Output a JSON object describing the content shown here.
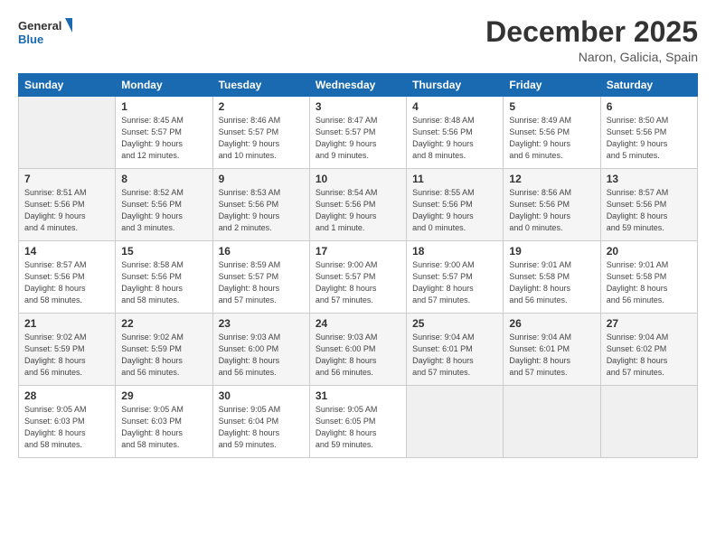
{
  "logo": {
    "line1": "General",
    "line2": "Blue"
  },
  "title": "December 2025",
  "location": "Naron, Galicia, Spain",
  "days_header": [
    "Sunday",
    "Monday",
    "Tuesday",
    "Wednesday",
    "Thursday",
    "Friday",
    "Saturday"
  ],
  "weeks": [
    [
      {
        "day": "",
        "info": ""
      },
      {
        "day": "1",
        "info": "Sunrise: 8:45 AM\nSunset: 5:57 PM\nDaylight: 9 hours\nand 12 minutes."
      },
      {
        "day": "2",
        "info": "Sunrise: 8:46 AM\nSunset: 5:57 PM\nDaylight: 9 hours\nand 10 minutes."
      },
      {
        "day": "3",
        "info": "Sunrise: 8:47 AM\nSunset: 5:57 PM\nDaylight: 9 hours\nand 9 minutes."
      },
      {
        "day": "4",
        "info": "Sunrise: 8:48 AM\nSunset: 5:56 PM\nDaylight: 9 hours\nand 8 minutes."
      },
      {
        "day": "5",
        "info": "Sunrise: 8:49 AM\nSunset: 5:56 PM\nDaylight: 9 hours\nand 6 minutes."
      },
      {
        "day": "6",
        "info": "Sunrise: 8:50 AM\nSunset: 5:56 PM\nDaylight: 9 hours\nand 5 minutes."
      }
    ],
    [
      {
        "day": "7",
        "info": "Sunrise: 8:51 AM\nSunset: 5:56 PM\nDaylight: 9 hours\nand 4 minutes."
      },
      {
        "day": "8",
        "info": "Sunrise: 8:52 AM\nSunset: 5:56 PM\nDaylight: 9 hours\nand 3 minutes."
      },
      {
        "day": "9",
        "info": "Sunrise: 8:53 AM\nSunset: 5:56 PM\nDaylight: 9 hours\nand 2 minutes."
      },
      {
        "day": "10",
        "info": "Sunrise: 8:54 AM\nSunset: 5:56 PM\nDaylight: 9 hours\nand 1 minute."
      },
      {
        "day": "11",
        "info": "Sunrise: 8:55 AM\nSunset: 5:56 PM\nDaylight: 9 hours\nand 0 minutes."
      },
      {
        "day": "12",
        "info": "Sunrise: 8:56 AM\nSunset: 5:56 PM\nDaylight: 9 hours\nand 0 minutes."
      },
      {
        "day": "13",
        "info": "Sunrise: 8:57 AM\nSunset: 5:56 PM\nDaylight: 8 hours\nand 59 minutes."
      }
    ],
    [
      {
        "day": "14",
        "info": "Sunrise: 8:57 AM\nSunset: 5:56 PM\nDaylight: 8 hours\nand 58 minutes."
      },
      {
        "day": "15",
        "info": "Sunrise: 8:58 AM\nSunset: 5:56 PM\nDaylight: 8 hours\nand 58 minutes."
      },
      {
        "day": "16",
        "info": "Sunrise: 8:59 AM\nSunset: 5:57 PM\nDaylight: 8 hours\nand 57 minutes."
      },
      {
        "day": "17",
        "info": "Sunrise: 9:00 AM\nSunset: 5:57 PM\nDaylight: 8 hours\nand 57 minutes."
      },
      {
        "day": "18",
        "info": "Sunrise: 9:00 AM\nSunset: 5:57 PM\nDaylight: 8 hours\nand 57 minutes."
      },
      {
        "day": "19",
        "info": "Sunrise: 9:01 AM\nSunset: 5:58 PM\nDaylight: 8 hours\nand 56 minutes."
      },
      {
        "day": "20",
        "info": "Sunrise: 9:01 AM\nSunset: 5:58 PM\nDaylight: 8 hours\nand 56 minutes."
      }
    ],
    [
      {
        "day": "21",
        "info": "Sunrise: 9:02 AM\nSunset: 5:59 PM\nDaylight: 8 hours\nand 56 minutes."
      },
      {
        "day": "22",
        "info": "Sunrise: 9:02 AM\nSunset: 5:59 PM\nDaylight: 8 hours\nand 56 minutes."
      },
      {
        "day": "23",
        "info": "Sunrise: 9:03 AM\nSunset: 6:00 PM\nDaylight: 8 hours\nand 56 minutes."
      },
      {
        "day": "24",
        "info": "Sunrise: 9:03 AM\nSunset: 6:00 PM\nDaylight: 8 hours\nand 56 minutes."
      },
      {
        "day": "25",
        "info": "Sunrise: 9:04 AM\nSunset: 6:01 PM\nDaylight: 8 hours\nand 57 minutes."
      },
      {
        "day": "26",
        "info": "Sunrise: 9:04 AM\nSunset: 6:01 PM\nDaylight: 8 hours\nand 57 minutes."
      },
      {
        "day": "27",
        "info": "Sunrise: 9:04 AM\nSunset: 6:02 PM\nDaylight: 8 hours\nand 57 minutes."
      }
    ],
    [
      {
        "day": "28",
        "info": "Sunrise: 9:05 AM\nSunset: 6:03 PM\nDaylight: 8 hours\nand 58 minutes."
      },
      {
        "day": "29",
        "info": "Sunrise: 9:05 AM\nSunset: 6:03 PM\nDaylight: 8 hours\nand 58 minutes."
      },
      {
        "day": "30",
        "info": "Sunrise: 9:05 AM\nSunset: 6:04 PM\nDaylight: 8 hours\nand 59 minutes."
      },
      {
        "day": "31",
        "info": "Sunrise: 9:05 AM\nSunset: 6:05 PM\nDaylight: 8 hours\nand 59 minutes."
      },
      {
        "day": "",
        "info": ""
      },
      {
        "day": "",
        "info": ""
      },
      {
        "day": "",
        "info": ""
      }
    ]
  ]
}
